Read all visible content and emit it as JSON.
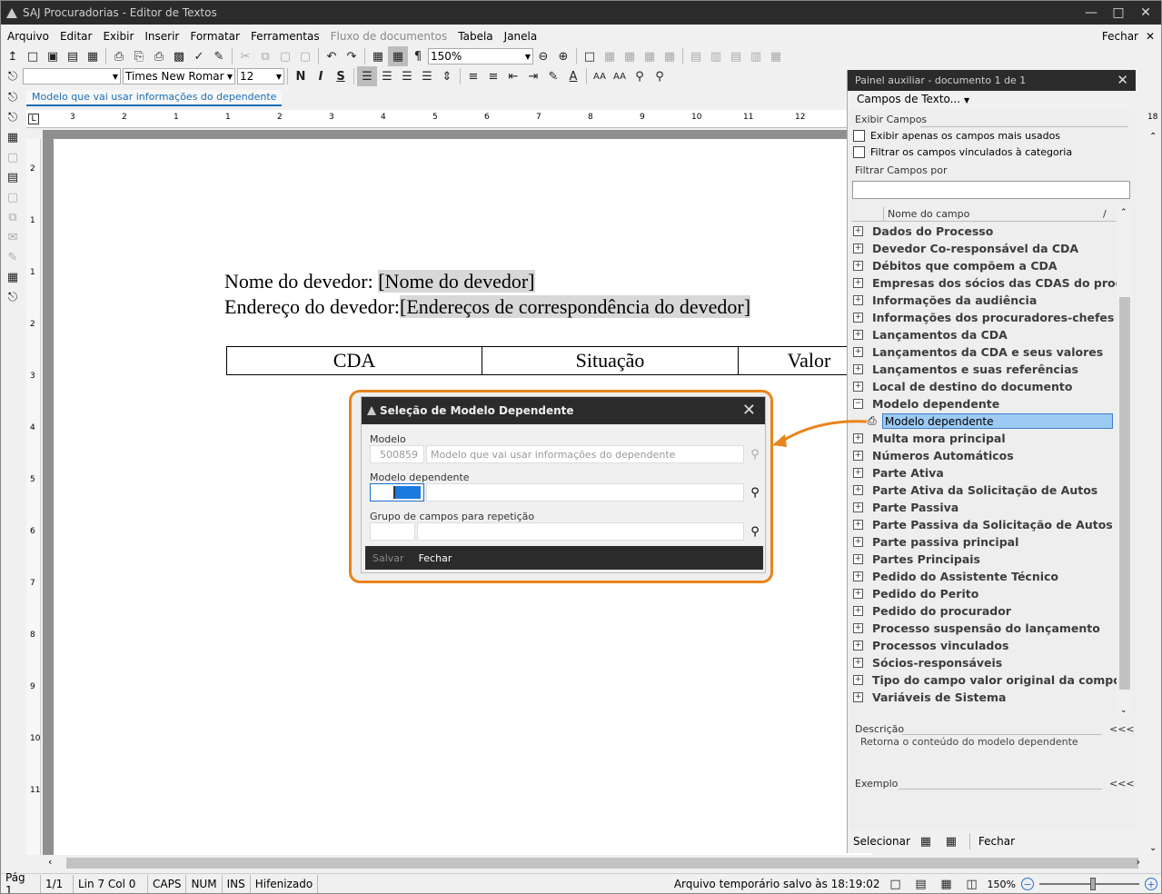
{
  "app": {
    "title": "SAJ Procuradorias - Editor de Textos"
  },
  "menu": {
    "items": [
      "Arquivo",
      "Editar",
      "Exibir",
      "Inserir",
      "Formatar",
      "Ferramentas"
    ],
    "disabled_item": "Fluxo de documentos",
    "items2": [
      "Tabela",
      "Janela"
    ],
    "close_label": "Fechar"
  },
  "toolbar": {
    "zoom": "150%",
    "font_name": "Times New Romar",
    "font_size": "12",
    "bold": "N",
    "italic": "I",
    "strike": "S"
  },
  "doc": {
    "tab": "Modelo que vai usar informações do dependente",
    "line1_label": "Nome do devedor: ",
    "line1_field": "[Nome do devedor]",
    "line2_label": "Endereço do devedor:",
    "line2_field": "[Endereços de correspondência do devedor]",
    "table_headers": [
      "CDA",
      "Situação",
      "Valor"
    ]
  },
  "ruler": {
    "h_marks": [
      "3",
      "2",
      "1",
      "1",
      "2",
      "3",
      "4",
      "5",
      "6",
      "7",
      "8",
      "9",
      "10",
      "11",
      "12"
    ],
    "h_end": "18",
    "v_marks": [
      "2",
      "1",
      "1",
      "2",
      "3",
      "4",
      "5",
      "6",
      "7",
      "8",
      "9",
      "10",
      "11"
    ]
  },
  "panel": {
    "title": "Painel auxiliar - documento 1 de 1",
    "dropdown": "Campos de Texto...",
    "exibir_label": "Exibir Campos",
    "chk1": "Exibir apenas os campos mais usados",
    "chk2": "Filtrar os campos vinculados à categoria",
    "filter_label": "Filtrar Campos por",
    "col_header": "Nome do campo",
    "tree_before": [
      "Dados do Processo",
      "Devedor Co-responsável da CDA",
      "Débitos que compõem a CDA",
      "Empresas dos sócios das CDAS do processo",
      "Informações da audiência",
      "Informações dos procuradores-chefes da",
      "Lançamentos da CDA",
      "Lançamentos da CDA e seus valores",
      "Lançamentos e suas referências",
      "Local de destino do documento"
    ],
    "expanded": "Modelo dependente",
    "selected_child": "Modelo dependente",
    "tree_after": [
      "Multa mora principal",
      "Números Automáticos",
      "Parte Ativa",
      "Parte Ativa da Solicitação de Autos",
      "Parte Passiva",
      "Parte Passiva da Solicitação de Autos",
      "Parte passiva principal",
      "Partes Principais",
      "Pedido do Assistente Técnico",
      "Pedido do Perito",
      "Pedido do procurador",
      "Processo suspensão do lançamento",
      "Processos vinculados",
      "Sócios-responsáveis",
      "Tipo do campo valor original da composição",
      "Variáveis de Sistema"
    ],
    "desc_label": "Descrição",
    "desc_text": "Retorna o conteúdo do modelo dependente",
    "example_label": "Exemplo",
    "collapse": "<<<",
    "select_label": "Selecionar",
    "close_label": "Fechar"
  },
  "dialog": {
    "title": "Seleção de Modelo Dependente",
    "modelo_label": "Modelo",
    "modelo_code": "500859",
    "modelo_name": "Modelo que vai usar informações do dependente",
    "dep_label": "Modelo dependente",
    "grupo_label": "Grupo de campos para repetição",
    "save": "Salvar",
    "close": "Fechar"
  },
  "status": {
    "page": "Pág 1",
    "pages": "1/1",
    "linecol": "Lin 7  Col 0",
    "caps": "CAPS",
    "num": "NUM",
    "ins": "INS",
    "hyph": "Hifenizado",
    "saved": "Arquivo temporário salvo às 18:19:02",
    "zoom": "150%"
  },
  "colors": {
    "accent": "#e8841b",
    "selection": "#9ccaf3",
    "titlebar": "#2b2b2b"
  }
}
